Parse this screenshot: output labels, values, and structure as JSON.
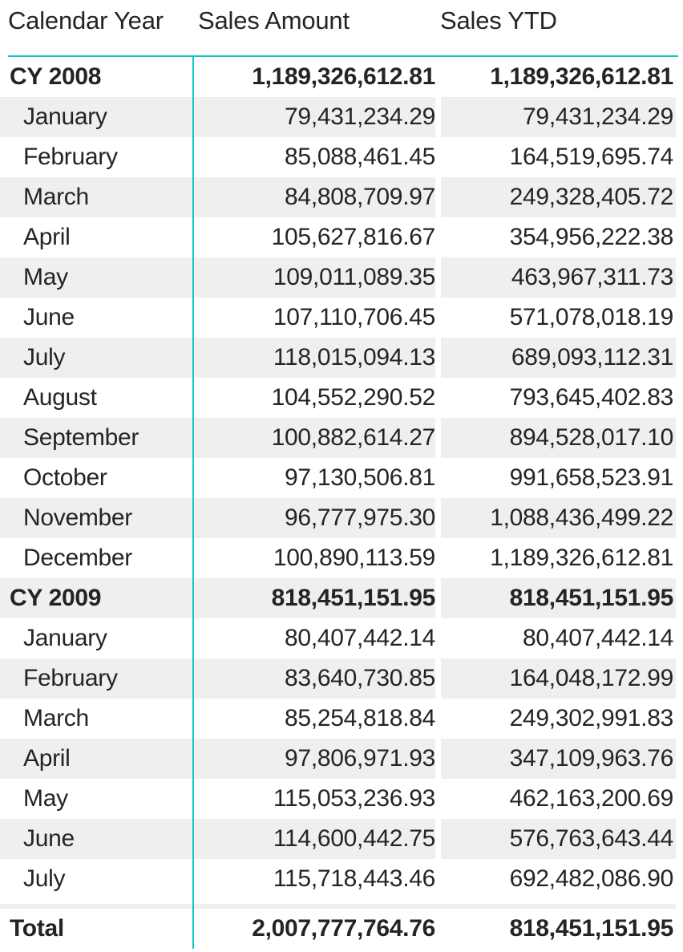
{
  "table": {
    "columns": [
      {
        "key": "calendar_year",
        "label": "Calendar Year",
        "align": "left"
      },
      {
        "key": "sales_amount",
        "label": "Sales Amount",
        "align": "right"
      },
      {
        "key": "sales_ytd",
        "label": "Sales YTD",
        "align": "right"
      }
    ],
    "accent_color": "#0FC6C2",
    "band_color": "#EFEFEF",
    "text_color": "#252423",
    "rows": [
      {
        "level": 0,
        "type": "subtotal",
        "band": false,
        "calendar_year": "CY 2008",
        "sales_amount": "1,189,326,612.81",
        "sales_ytd": "1,189,326,612.81"
      },
      {
        "level": 1,
        "type": "detail",
        "band": true,
        "calendar_year": "January",
        "sales_amount": "79,431,234.29",
        "sales_ytd": "79,431,234.29"
      },
      {
        "level": 1,
        "type": "detail",
        "band": false,
        "calendar_year": "February",
        "sales_amount": "85,088,461.45",
        "sales_ytd": "164,519,695.74"
      },
      {
        "level": 1,
        "type": "detail",
        "band": true,
        "calendar_year": "March",
        "sales_amount": "84,808,709.97",
        "sales_ytd": "249,328,405.72"
      },
      {
        "level": 1,
        "type": "detail",
        "band": false,
        "calendar_year": "April",
        "sales_amount": "105,627,816.67",
        "sales_ytd": "354,956,222.38"
      },
      {
        "level": 1,
        "type": "detail",
        "band": true,
        "calendar_year": "May",
        "sales_amount": "109,011,089.35",
        "sales_ytd": "463,967,311.73"
      },
      {
        "level": 1,
        "type": "detail",
        "band": false,
        "calendar_year": "June",
        "sales_amount": "107,110,706.45",
        "sales_ytd": "571,078,018.19"
      },
      {
        "level": 1,
        "type": "detail",
        "band": true,
        "calendar_year": "July",
        "sales_amount": "118,015,094.13",
        "sales_ytd": "689,093,112.31"
      },
      {
        "level": 1,
        "type": "detail",
        "band": false,
        "calendar_year": "August",
        "sales_amount": "104,552,290.52",
        "sales_ytd": "793,645,402.83"
      },
      {
        "level": 1,
        "type": "detail",
        "band": true,
        "calendar_year": "September",
        "sales_amount": "100,882,614.27",
        "sales_ytd": "894,528,017.10"
      },
      {
        "level": 1,
        "type": "detail",
        "band": false,
        "calendar_year": "October",
        "sales_amount": "97,130,506.81",
        "sales_ytd": "991,658,523.91"
      },
      {
        "level": 1,
        "type": "detail",
        "band": true,
        "calendar_year": "November",
        "sales_amount": "96,777,975.30",
        "sales_ytd": "1,088,436,499.22"
      },
      {
        "level": 1,
        "type": "detail",
        "band": false,
        "calendar_year": "December",
        "sales_amount": "100,890,113.59",
        "sales_ytd": "1,189,326,612.81"
      },
      {
        "level": 0,
        "type": "subtotal",
        "band": true,
        "calendar_year": "CY 2009",
        "sales_amount": "818,451,151.95",
        "sales_ytd": "818,451,151.95"
      },
      {
        "level": 1,
        "type": "detail",
        "band": false,
        "calendar_year": "January",
        "sales_amount": "80,407,442.14",
        "sales_ytd": "80,407,442.14"
      },
      {
        "level": 1,
        "type": "detail",
        "band": true,
        "calendar_year": "February",
        "sales_amount": "83,640,730.85",
        "sales_ytd": "164,048,172.99"
      },
      {
        "level": 1,
        "type": "detail",
        "band": false,
        "calendar_year": "March",
        "sales_amount": "85,254,818.84",
        "sales_ytd": "249,302,991.83"
      },
      {
        "level": 1,
        "type": "detail",
        "band": true,
        "calendar_year": "April",
        "sales_amount": "97,806,971.93",
        "sales_ytd": "347,109,963.76"
      },
      {
        "level": 1,
        "type": "detail",
        "band": false,
        "calendar_year": "May",
        "sales_amount": "115,053,236.93",
        "sales_ytd": "462,163,200.69"
      },
      {
        "level": 1,
        "type": "detail",
        "band": true,
        "calendar_year": "June",
        "sales_amount": "114,600,442.75",
        "sales_ytd": "576,763,643.44"
      },
      {
        "level": 1,
        "type": "detail",
        "band": false,
        "calendar_year": "July",
        "sales_amount": "115,718,443.46",
        "sales_ytd": "692,482,086.90"
      }
    ],
    "total_row": {
      "calendar_year": "Total",
      "sales_amount": "2,007,777,764.76",
      "sales_ytd": "818,451,151.95"
    }
  }
}
